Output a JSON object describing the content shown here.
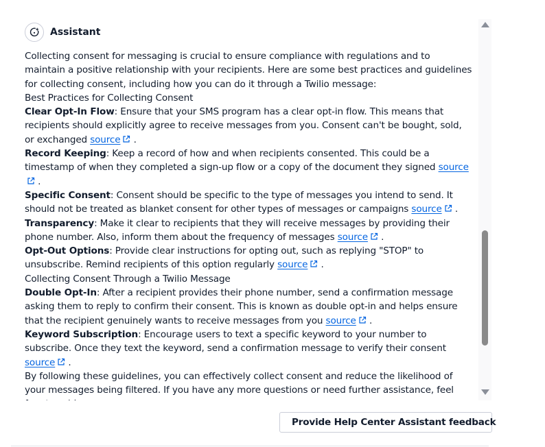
{
  "assistant": {
    "title": "Assistant"
  },
  "message": {
    "intro": "Collecting consent for messaging is crucial to ensure compliance with regulations and to maintain a positive relationship with your recipients. Here are some best practices and guidelines for collecting consent, including how you can do it through a Twilio message:",
    "section1_heading": "Best Practices for Collecting Consent",
    "items": [
      {
        "term": "Clear Opt-In Flow",
        "text": ": Ensure that your SMS program has a clear opt-in flow. This means that recipients should explicitly agree to receive messages from you. Consent can't be bought, sold, or exchanged ",
        "link": "source"
      },
      {
        "term": "Record Keeping",
        "text": ": Keep a record of how and when recipients consented. This could be a timestamp of when they completed a sign-up flow or a copy of the document they signed ",
        "link": "source"
      },
      {
        "term": "Specific Consent",
        "text": ": Consent should be specific to the type of messages you intend to send. It should not be treated as blanket consent for other types of messages or campaigns ",
        "link": "source"
      },
      {
        "term": "Transparency",
        "text": ": Make it clear to recipients that they will receive messages by providing their phone number. Also, inform them about the frequency of messages ",
        "link": "source"
      },
      {
        "term": "Opt-Out Options",
        "text": ": Provide clear instructions for opting out, such as replying \"STOP\" to unsubscribe. Remind recipients of this option regularly ",
        "link": "source"
      }
    ],
    "section2_heading": "Collecting Consent Through a Twilio Message",
    "items2": [
      {
        "term": "Double Opt-In",
        "text": ": After a recipient provides their phone number, send a confirmation message asking them to reply to confirm their consent. This is known as double opt-in and helps ensure that the recipient genuinely wants to receive messages from you ",
        "link": "source"
      },
      {
        "term": "Keyword Subscription",
        "text": ": Encourage users to text a specific keyword to your number to subscribe. Once they text the keyword, send a confirmation message to verify their consent ",
        "link": "source"
      }
    ],
    "outro": "By following these guidelines, you can effectively collect consent and reduce the likelihood of your messages being filtered. If you have any more questions or need further assistance, feel free to ask!",
    "link_suffix": "."
  },
  "feedback": {
    "label": "Provide Help Center Assistant feedback"
  },
  "colors": {
    "link": "#0263e0",
    "text": "#121c2d",
    "scrollbar_thumb": "#8a8a8a"
  }
}
